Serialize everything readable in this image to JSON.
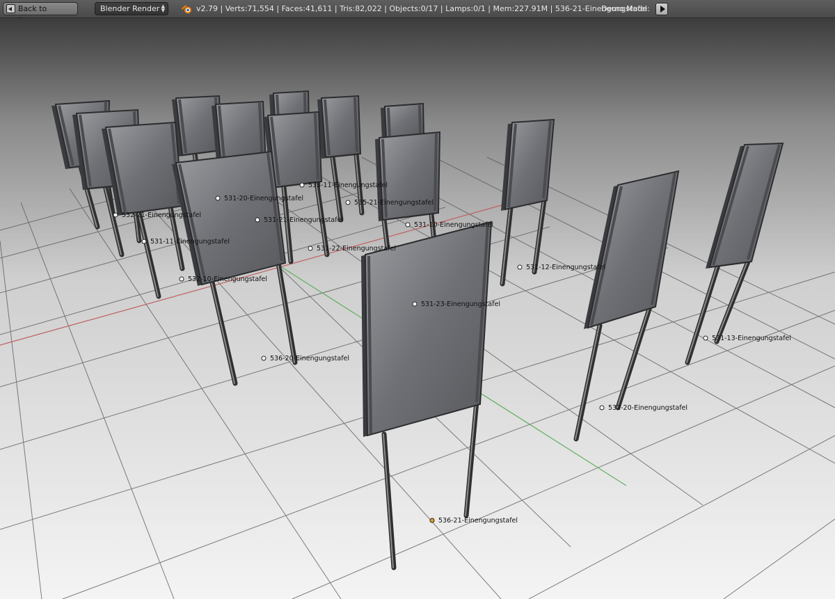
{
  "header": {
    "back_label": "Back to Previous",
    "engine": "Blender Render",
    "stats": "v2.79 | Verts:71,554 | Faces:41,611 | Tris:82,022 | Objects:0/17 | Lamps:0/1 | Mem:227.91M | 536-21-Einengungstafel",
    "demo_mode": "Demo Mode:"
  },
  "icons": {
    "back": "back-icon",
    "logo": "blender-logo-icon",
    "play": "play-icon"
  },
  "colors": {
    "header_bg": "#4a4a4a",
    "x_axis": "#c06060",
    "y_axis": "#60b060",
    "selected_origin": "#e8a020"
  },
  "scene": {
    "labels": [
      "536-21-Einengungstafel",
      "536-20-Einengungstafel",
      "531-23-Einengungstafel",
      "532-20-Einengungstafel",
      "531-13-Einengungstafel",
      "531-12-Einengungstafel",
      "532-10-Einengungstafel",
      "531-11-Einengungstafel",
      "532-21-Einengungstafel",
      "531-20-Einengungstafel",
      "531-21-Einengungstafel",
      "531-22-Einengungstafel",
      "535-21-Einengungstafel",
      "531-10-Einengungstafel",
      "533-11-Einengungstafel"
    ],
    "selected": "536-21-Einengungstafel"
  }
}
